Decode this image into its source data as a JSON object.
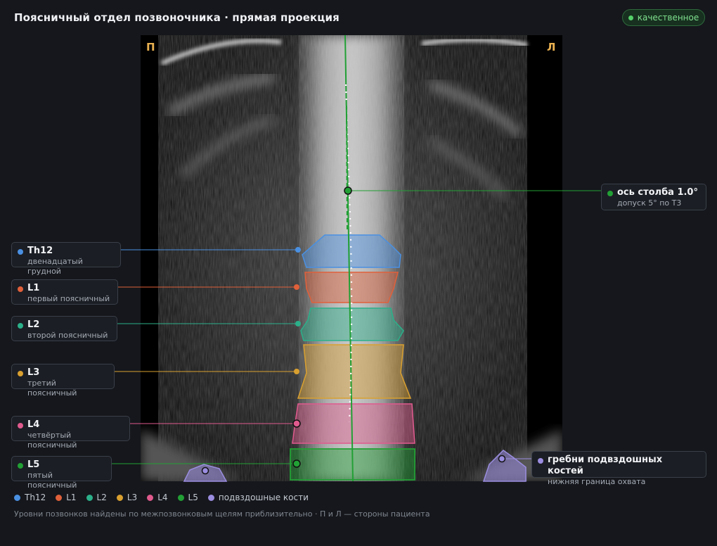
{
  "title": "Поясничный отдел позвоночника · прямая проекция",
  "quality_badge": "качественное",
  "side_labels": {
    "right": "П",
    "left": "Л"
  },
  "colors": {
    "th12": "#4a90e2",
    "l1": "#e0603a",
    "l2": "#2bb08a",
    "l3": "#d9a030",
    "l4": "#e05a8e",
    "l5": "#22a035",
    "iliac": "#9b8de0",
    "axis": "#22a035"
  },
  "callouts": {
    "axis": {
      "name": "ось столба 1.0°",
      "sub": "допуск 5° по Т3"
    },
    "th12": {
      "name": "Th12",
      "sub": "двенадцатый грудной"
    },
    "l1": {
      "name": "L1",
      "sub": "первый поясничный"
    },
    "l2": {
      "name": "L2",
      "sub": "второй поясничный"
    },
    "l3": {
      "name": "L3",
      "sub": "третий поясничный"
    },
    "l4": {
      "name": "L4",
      "sub": "четвёртый поясничный"
    },
    "l5": {
      "name": "L5",
      "sub": "пятый поясничный"
    },
    "iliac": {
      "name": "гребни подвздошных костей",
      "sub": "нижняя граница охвата"
    }
  },
  "legend": [
    "Th12",
    "L1",
    "L2",
    "L3",
    "L4",
    "L5",
    "подвздошные кости"
  ],
  "footnote": "Уровни позвонков найдены по межпозвонковым щелям приблизительно · П и Л — стороны пациента"
}
